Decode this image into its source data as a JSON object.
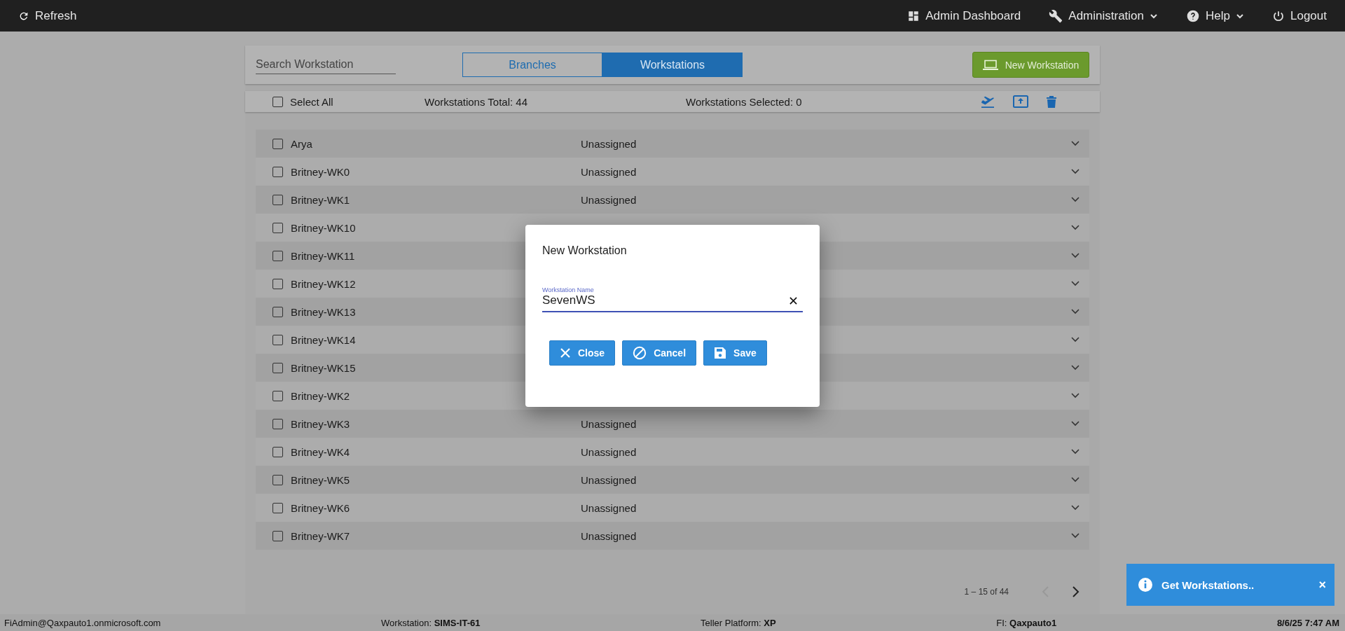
{
  "top_bar": {
    "refresh": "Refresh",
    "menu": [
      {
        "kind": "dashboard",
        "label": "Admin Dashboard",
        "dropdown": false
      },
      {
        "kind": "wrench",
        "label": "Administration",
        "dropdown": true
      },
      {
        "kind": "help",
        "label": "Help",
        "dropdown": true
      },
      {
        "kind": "power",
        "label": "Logout",
        "dropdown": false
      }
    ]
  },
  "search": {
    "placeholder": "Search Workstation"
  },
  "tabs": [
    {
      "label": "Branches",
      "selected": false
    },
    {
      "label": "Workstations",
      "selected": true
    }
  ],
  "new_button": "New Workstation",
  "toolbar": {
    "select_all": {
      "label": "Select All",
      "checked": false
    },
    "total": "Workstations Total: 44",
    "selected_count": "Workstations Selected: 0"
  },
  "rows": [
    {
      "name": "Arya",
      "status": "Unassigned",
      "checked": false
    },
    {
      "name": "Britney-WK0",
      "status": "Unassigned",
      "checked": false
    },
    {
      "name": "Britney-WK1",
      "status": "Unassigned",
      "checked": false
    },
    {
      "name": "Britney-WK10",
      "checked": false
    },
    {
      "name": "Britney-WK11",
      "checked": false
    },
    {
      "name": "Britney-WK12",
      "checked": false
    },
    {
      "name": "Britney-WK13",
      "checked": false
    },
    {
      "name": "Britney-WK14",
      "checked": false
    },
    {
      "name": "Britney-WK15",
      "checked": false
    },
    {
      "name": "Britney-WK2",
      "checked": false
    },
    {
      "name": "Britney-WK3",
      "status": "Unassigned",
      "checked": false
    },
    {
      "name": "Britney-WK4",
      "status": "Unassigned",
      "checked": false
    },
    {
      "name": "Britney-WK5",
      "status": "Unassigned",
      "checked": false
    },
    {
      "name": "Britney-WK6",
      "status": "Unassigned",
      "checked": false
    },
    {
      "name": "Britney-WK7",
      "status": "Unassigned",
      "checked": false
    }
  ],
  "pagination": {
    "range": "1 – 15 of 44",
    "prev_disabled": true
  },
  "status_bar": {
    "user": "FiAdmin@Qaxpauto1.onmicrosoft.com",
    "workstation_label": "Workstation:",
    "workstation": "SIMS-IT-61",
    "platform_label": "Teller Platform:",
    "platform": "XP",
    "fi_label": "FI:",
    "fi": "Qaxpauto1",
    "datetime": "8/6/25 7:47 AM"
  },
  "dialog": {
    "title": "New Workstation",
    "field_label": "Workstation Name",
    "field_value": "SevenWS",
    "buttons": [
      {
        "kind": "close",
        "label": "Close"
      },
      {
        "kind": "cancel",
        "label": "Cancel"
      },
      {
        "kind": "save",
        "label": "Save"
      }
    ]
  },
  "toast": {
    "message": "Get Workstations..",
    "close": "×"
  }
}
